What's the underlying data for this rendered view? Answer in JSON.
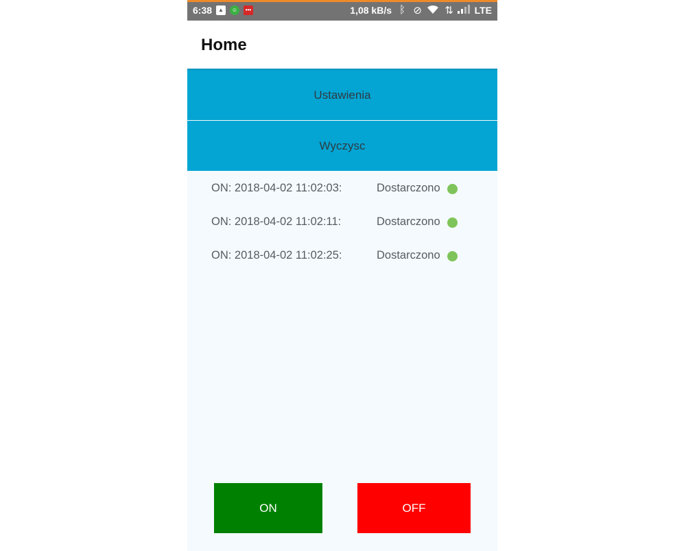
{
  "status_bar": {
    "time": "6:38",
    "app_icons": [
      {
        "name": "photos-icon",
        "glyph": "▲"
      },
      {
        "name": "android-icon",
        "glyph": "☺"
      },
      {
        "name": "messages-icon",
        "glyph": "•••"
      }
    ],
    "network_speed": "1,08 kB/s",
    "network_type": "LTE",
    "accent_color": "#ef8a2a"
  },
  "app_bar": {
    "title": "Home"
  },
  "actions": {
    "settings_label": "Ustawienia",
    "clear_label": "Wyczysc"
  },
  "log": [
    {
      "entry": "ON: 2018-04-02 11:02:03:",
      "status": "Dostarczono",
      "status_color": "#7fc45a"
    },
    {
      "entry": "ON: 2018-04-02 11:02:11:",
      "status": "Dostarczono",
      "status_color": "#7fc45a"
    },
    {
      "entry": "ON: 2018-04-02 11:02:25:",
      "status": "Dostarczono",
      "status_color": "#7fc45a"
    }
  ],
  "controls": {
    "on_label": "ON",
    "on_color": "#008000",
    "off_label": "OFF",
    "off_color": "#ff0000"
  },
  "colors": {
    "primary": "#04a5d3",
    "background": "#f4fafd"
  }
}
